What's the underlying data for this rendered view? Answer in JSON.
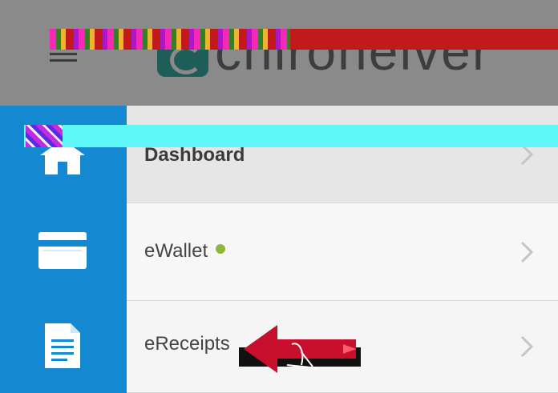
{
  "header": {
    "menu_icon": "hamburger-menu-icon",
    "logo_text": "chirohelver",
    "logo_icon": "logo-mark-icon"
  },
  "sidebar": {
    "icons": [
      "home-icon",
      "card-icon",
      "document-icon"
    ],
    "color": "#1488d1"
  },
  "menu": {
    "items": [
      {
        "label": "Dashboard",
        "icon": "home-icon",
        "active": true
      },
      {
        "label": "eWallet",
        "icon": "card-icon",
        "status": "online",
        "status_color": "#8cb83a"
      },
      {
        "label": "eReceipts",
        "icon": "document-icon"
      }
    ]
  },
  "colors": {
    "accent": "#1488d1",
    "header_overlay": "#8a8a8a",
    "annotation_red": "#c8102e"
  }
}
